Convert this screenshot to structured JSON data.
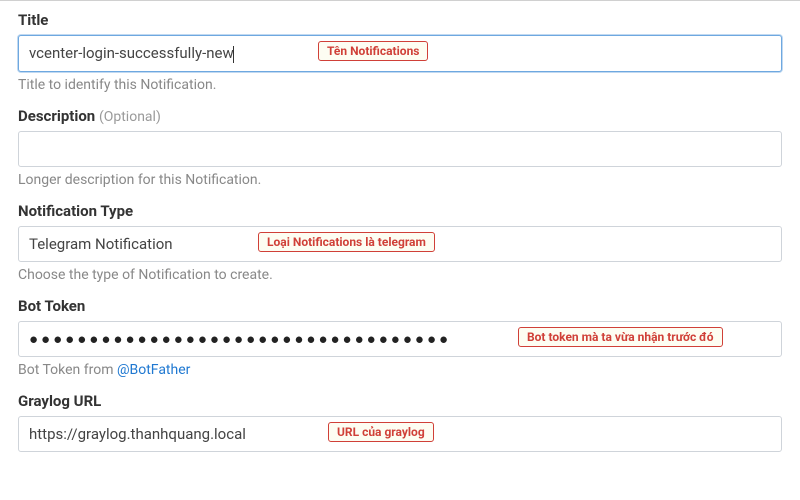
{
  "top_right": "",
  "fields": {
    "title": {
      "label": "Title",
      "value": "vcenter-login-successfully-new",
      "help": "Title to identify this Notification.",
      "callout": "Tên Notifications"
    },
    "description": {
      "label": "Description",
      "optional": "(Optional)",
      "value": "",
      "help": "Longer description for this Notification."
    },
    "type": {
      "label": "Notification Type",
      "value": "Telegram Notification",
      "help": "Choose the type of Notification to create.",
      "callout": "Loại Notifications là telegram"
    },
    "token": {
      "label": "Bot Token",
      "value": "●●●●●●●●●●●●●●●●●●●●●●●●●●●●●●●●●●●",
      "help_prefix": "Bot Token from ",
      "help_link": "@BotFather",
      "callout": "Bot token mà ta vừa nhận trước đó"
    },
    "url": {
      "label": "Graylog URL",
      "value": "https://graylog.thanhquang.local",
      "callout": "URL của graylog"
    }
  }
}
